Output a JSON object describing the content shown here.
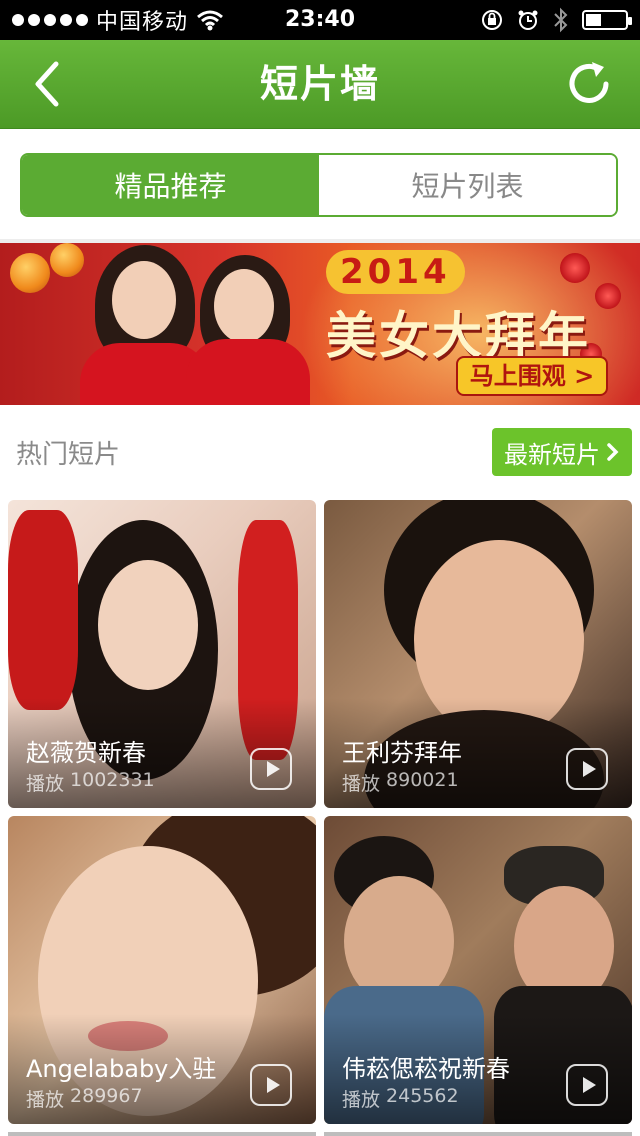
{
  "status_bar": {
    "carrier": "中国移动",
    "time": "23:40",
    "battery_level": 0.4,
    "signal_bars": 5
  },
  "nav": {
    "title": "短片墙",
    "back_icon": "chevron-left-icon",
    "refresh_icon": "refresh-icon"
  },
  "tabs": [
    {
      "label": "精品推荐",
      "active": true
    },
    {
      "label": "短片列表",
      "active": false
    }
  ],
  "banner": {
    "year": "2014",
    "slogan": "美女大拜年",
    "button": "马上围观 >"
  },
  "section": {
    "title": "热门短片",
    "more_button": "最新短片"
  },
  "videos": [
    {
      "title": "赵薇贺新春",
      "plays_label": "播放",
      "plays": "1002331"
    },
    {
      "title": "王利芬拜年",
      "plays_label": "播放",
      "plays": "890021"
    },
    {
      "title": "Angelababy入驻",
      "plays_label": "播放",
      "plays": "289967"
    },
    {
      "title": "伟菘偲菘祝新春",
      "plays_label": "播放",
      "plays": "245562"
    }
  ],
  "colors": {
    "nav_green": "#5bab33",
    "button_green": "#6cc32b",
    "banner_red": "#d7342b"
  }
}
